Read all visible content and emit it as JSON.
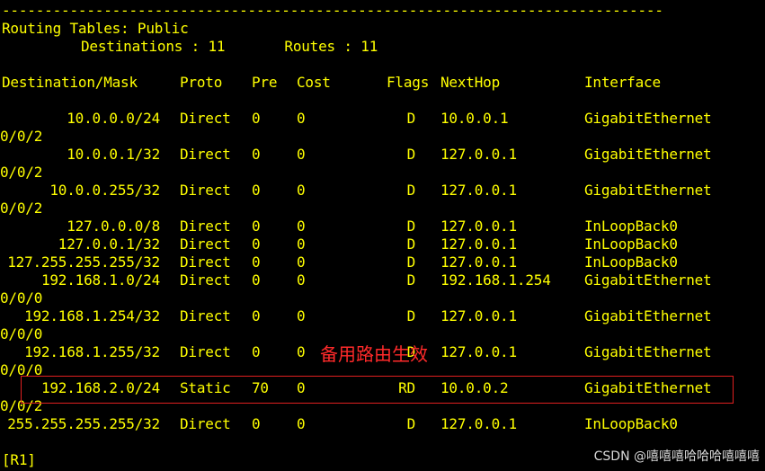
{
  "terminal": {
    "divider": "------------------------------------------------------------------------------",
    "title": "Routing Tables: Public",
    "summary": "Destinations : 11       Routes : 11",
    "prompt": "[R1]"
  },
  "columns": {
    "destination": "Destination/Mask",
    "proto": "Proto",
    "pre": "Pre",
    "cost": "Cost",
    "flags": "Flags",
    "nexthop": "NextHop",
    "interface": "Interface"
  },
  "routes": [
    {
      "dest": "10.0.0.0/24",
      "proto": "Direct",
      "pre": "0",
      "cost": "0",
      "flags": "D",
      "nexthop": "10.0.0.1",
      "intf": "GigabitEthernet",
      "wrap": "0/0/2"
    },
    {
      "dest": "10.0.0.1/32",
      "proto": "Direct",
      "pre": "0",
      "cost": "0",
      "flags": "D",
      "nexthop": "127.0.0.1",
      "intf": "GigabitEthernet",
      "wrap": "0/0/2"
    },
    {
      "dest": "10.0.0.255/32",
      "proto": "Direct",
      "pre": "0",
      "cost": "0",
      "flags": "D",
      "nexthop": "127.0.0.1",
      "intf": "GigabitEthernet",
      "wrap": "0/0/2"
    },
    {
      "dest": "127.0.0.0/8",
      "proto": "Direct",
      "pre": "0",
      "cost": "0",
      "flags": "D",
      "nexthop": "127.0.0.1",
      "intf": "InLoopBack0",
      "wrap": ""
    },
    {
      "dest": "127.0.0.1/32",
      "proto": "Direct",
      "pre": "0",
      "cost": "0",
      "flags": "D",
      "nexthop": "127.0.0.1",
      "intf": "InLoopBack0",
      "wrap": ""
    },
    {
      "dest": "127.255.255.255/32",
      "proto": "Direct",
      "pre": "0",
      "cost": "0",
      "flags": "D",
      "nexthop": "127.0.0.1",
      "intf": "InLoopBack0",
      "wrap": ""
    },
    {
      "dest": "192.168.1.0/24",
      "proto": "Direct",
      "pre": "0",
      "cost": "0",
      "flags": "D",
      "nexthop": "192.168.1.254",
      "intf": "GigabitEthernet",
      "wrap": "0/0/0"
    },
    {
      "dest": "192.168.1.254/32",
      "proto": "Direct",
      "pre": "0",
      "cost": "0",
      "flags": "D",
      "nexthop": "127.0.0.1",
      "intf": "GigabitEthernet",
      "wrap": "0/0/0"
    },
    {
      "dest": "192.168.1.255/32",
      "proto": "Direct",
      "pre": "0",
      "cost": "0",
      "flags": "D",
      "nexthop": "127.0.0.1",
      "intf": "GigabitEthernet",
      "wrap": "0/0/0"
    },
    {
      "dest": "192.168.2.0/24",
      "proto": "Static",
      "pre": "70",
      "cost": "0",
      "flags": "RD",
      "nexthop": "10.0.0.2",
      "intf": "GigabitEthernet",
      "wrap": "0/0/2"
    },
    {
      "dest": "255.255.255.255/32",
      "proto": "Direct",
      "pre": "0",
      "cost": "0",
      "flags": "D",
      "nexthop": "127.0.0.1",
      "intf": "InLoopBack0",
      "wrap": ""
    }
  ],
  "annotation": "备用路由生效",
  "watermark": "CSDN @嘻嘻嘻哈哈哈嘻嘻嘻",
  "colors": {
    "background": "#000000",
    "terminal_text": "#ffff00",
    "annotation": "#ff2a2a",
    "highlight_border": "#e02020",
    "watermark": "#d9d9d9"
  }
}
